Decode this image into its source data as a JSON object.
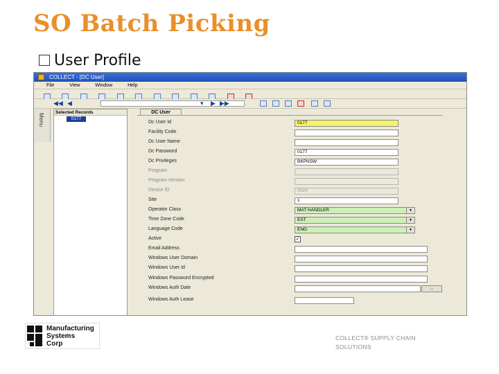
{
  "slide": {
    "title": "SO Batch Picking",
    "bullet": "User Profile"
  },
  "window": {
    "title": "COLLECT - [DC User]",
    "menu": [
      "File",
      "View",
      "Window",
      "Help"
    ]
  },
  "side_menu_label": "Menu",
  "records": {
    "header": "Selected Records",
    "items": [
      "0177"
    ]
  },
  "form": {
    "tab": "DC User",
    "fields": [
      {
        "label": "Dc User Id",
        "value": "0177",
        "style": "yellow"
      },
      {
        "label": "Facility Code",
        "value": "",
        "style": "plain"
      },
      {
        "label": "Dc User Name",
        "value": "",
        "style": "plain"
      },
      {
        "label": "Dc Password",
        "value": "0177",
        "style": "plain"
      },
      {
        "label": "Dc Privileges",
        "value": "BKPNSW",
        "style": "plain"
      },
      {
        "label": "Program",
        "value": "",
        "style": "dim"
      },
      {
        "label": "Program Version",
        "value": "",
        "style": "dim"
      },
      {
        "label": "Device ID",
        "value": "002H",
        "style": "dim"
      },
      {
        "label": "Site",
        "value": "1",
        "style": "plain"
      },
      {
        "label": "Operator Class",
        "value": "MAT HANDLER",
        "style": "green-dropdown"
      },
      {
        "label": "Time Zone Code",
        "value": "EST",
        "style": "green-dropdown"
      },
      {
        "label": "Language Code",
        "value": "ENG",
        "style": "green-dropdown"
      },
      {
        "label": "Active",
        "value": "✓",
        "style": "checkbox"
      },
      {
        "label": "Email Address",
        "value": "",
        "style": "plain-wide"
      },
      {
        "label": "Windows User Domain",
        "value": "",
        "style": "plain-wide"
      },
      {
        "label": "Windows User Id",
        "value": "",
        "style": "plain-wide"
      },
      {
        "label": "Windows Password Encrypted",
        "value": "",
        "style": "plain-wide"
      },
      {
        "label": "Windows Auth Date",
        "value": "",
        "style": "date"
      },
      {
        "label": "Windows Auth Lease",
        "value": "",
        "style": "plain-short"
      }
    ],
    "ellipsis": "..."
  },
  "logo": {
    "lines": [
      "Manufacturing",
      "Systems",
      "Corp"
    ]
  },
  "footer": {
    "line1": "COLLECT® SUPPLY CHAIN",
    "line2": "SOLUTIONS"
  },
  "colors": {
    "title_orange": "#e8902a",
    "required_yellow": "#f7f26a",
    "lookup_green": "#ccf0b8",
    "record_selected": "#1d3e9a"
  }
}
